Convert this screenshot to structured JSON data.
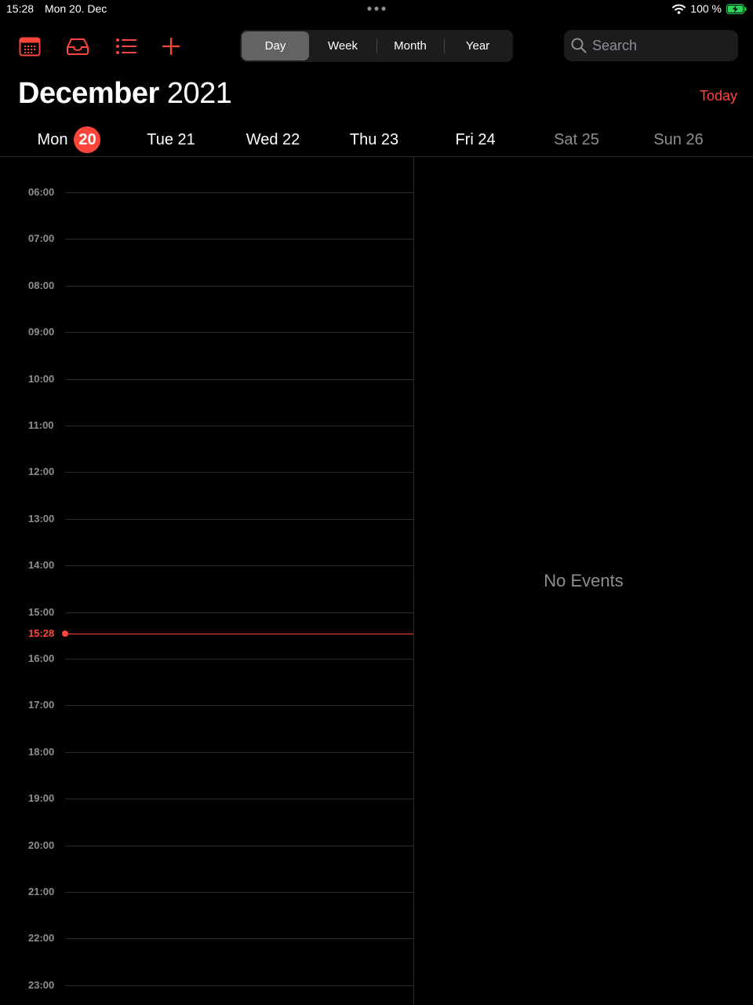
{
  "status_bar": {
    "time": "15:28",
    "date": "Mon 20. Dec",
    "battery": "100 %"
  },
  "toolbar": {
    "views": [
      {
        "label": "Day",
        "active": true
      },
      {
        "label": "Week",
        "active": false
      },
      {
        "label": "Month",
        "active": false
      },
      {
        "label": "Year",
        "active": false
      }
    ],
    "search_placeholder": "Search"
  },
  "header": {
    "month": "December",
    "year": "2021",
    "today_label": "Today"
  },
  "week": [
    {
      "label": "Mon",
      "number": "20",
      "selected": true,
      "weekend": false
    },
    {
      "label": "Tue 21",
      "selected": false,
      "weekend": false
    },
    {
      "label": "Wed 22",
      "selected": false,
      "weekend": false
    },
    {
      "label": "Thu 23",
      "selected": false,
      "weekend": false
    },
    {
      "label": "Fri 24",
      "selected": false,
      "weekend": false
    },
    {
      "label": "Sat 25",
      "selected": false,
      "weekend": true
    },
    {
      "label": "Sun 26",
      "selected": false,
      "weekend": true
    }
  ],
  "hours": [
    "06:00",
    "07:00",
    "08:00",
    "09:00",
    "10:00",
    "11:00",
    "12:00",
    "13:00",
    "14:00",
    "15:00",
    "16:00",
    "17:00",
    "18:00",
    "19:00",
    "20:00",
    "21:00",
    "22:00",
    "23:00"
  ],
  "current_time": "15:28",
  "empty_state": "No Events",
  "colors": {
    "accent": "#ff453a",
    "background": "#000000",
    "secondary_text": "#8e8e93"
  }
}
